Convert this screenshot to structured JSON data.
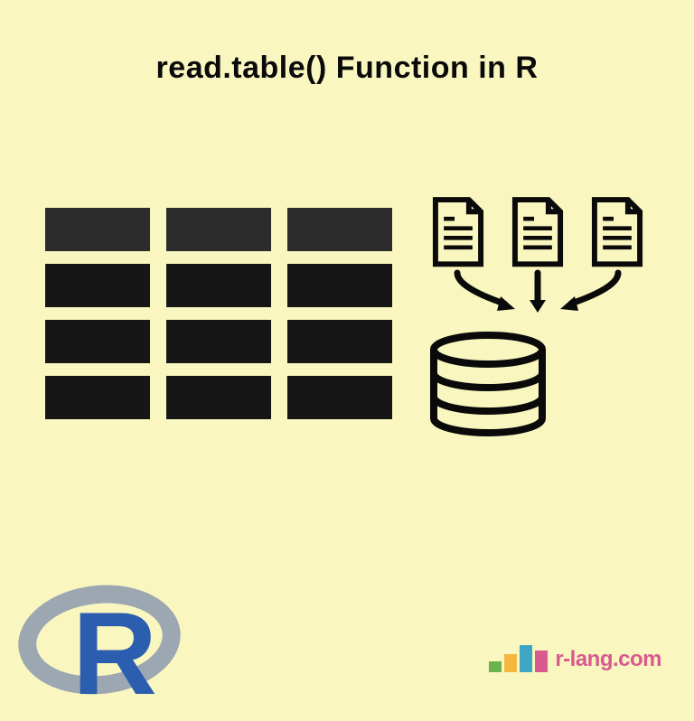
{
  "title": "read.table() Function in R",
  "diagram": {
    "table_grid": {
      "rows": 4,
      "cols": 3,
      "header_row": true
    },
    "file_count": 3,
    "database": "stacked-cylinder"
  },
  "bottom_left_logo": {
    "letter": "R"
  },
  "bottom_right": {
    "bars": [
      "#6cb34f",
      "#f4b63f",
      "#3fa5c4",
      "#d85a8f"
    ],
    "site_name": "r-lang.com"
  }
}
